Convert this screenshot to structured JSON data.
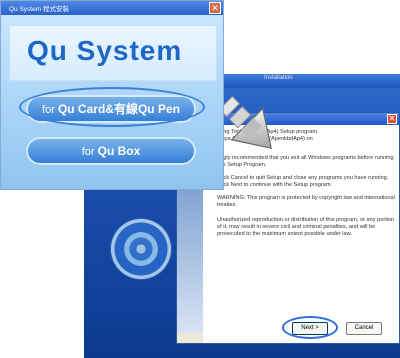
{
  "launcher": {
    "window_title": "Qu System 程式安裝",
    "logo_text": "Qu System",
    "option_card": {
      "prefix": "for ",
      "brand": "Qu Card&有線Qu Pen"
    },
    "option_box": {
      "prefix": "for ",
      "brand": "Qu Box"
    }
  },
  "installer": {
    "window_title": "Installation",
    "intro_line1": "oring Tool (ApenkbdAp4) Setup program.",
    "intro_line2": "Maya Authoring Tool (ApenkbdAp4) on",
    "intro_frag": "pu",
    "para1": "ongly recommended that you exit all Windows programs before running this Setup Program.",
    "para2": "Click Cancel to quit Setup and close any programs you have running.  Click Next to continue with the Setup program.",
    "para3": "WARNING: This program is protected by copyright law and international treaties.",
    "para4": "Unauthorized reproduction or distribution of this program, or any portion of it, may result in severe civil and criminal penalties, and will be prosecuted to the maximum extent possible under law.",
    "next_label": "Next >",
    "cancel_label": "Cancel"
  },
  "colors": {
    "accent": "#2f6fd7",
    "brand_blue": "#1e67c6"
  }
}
